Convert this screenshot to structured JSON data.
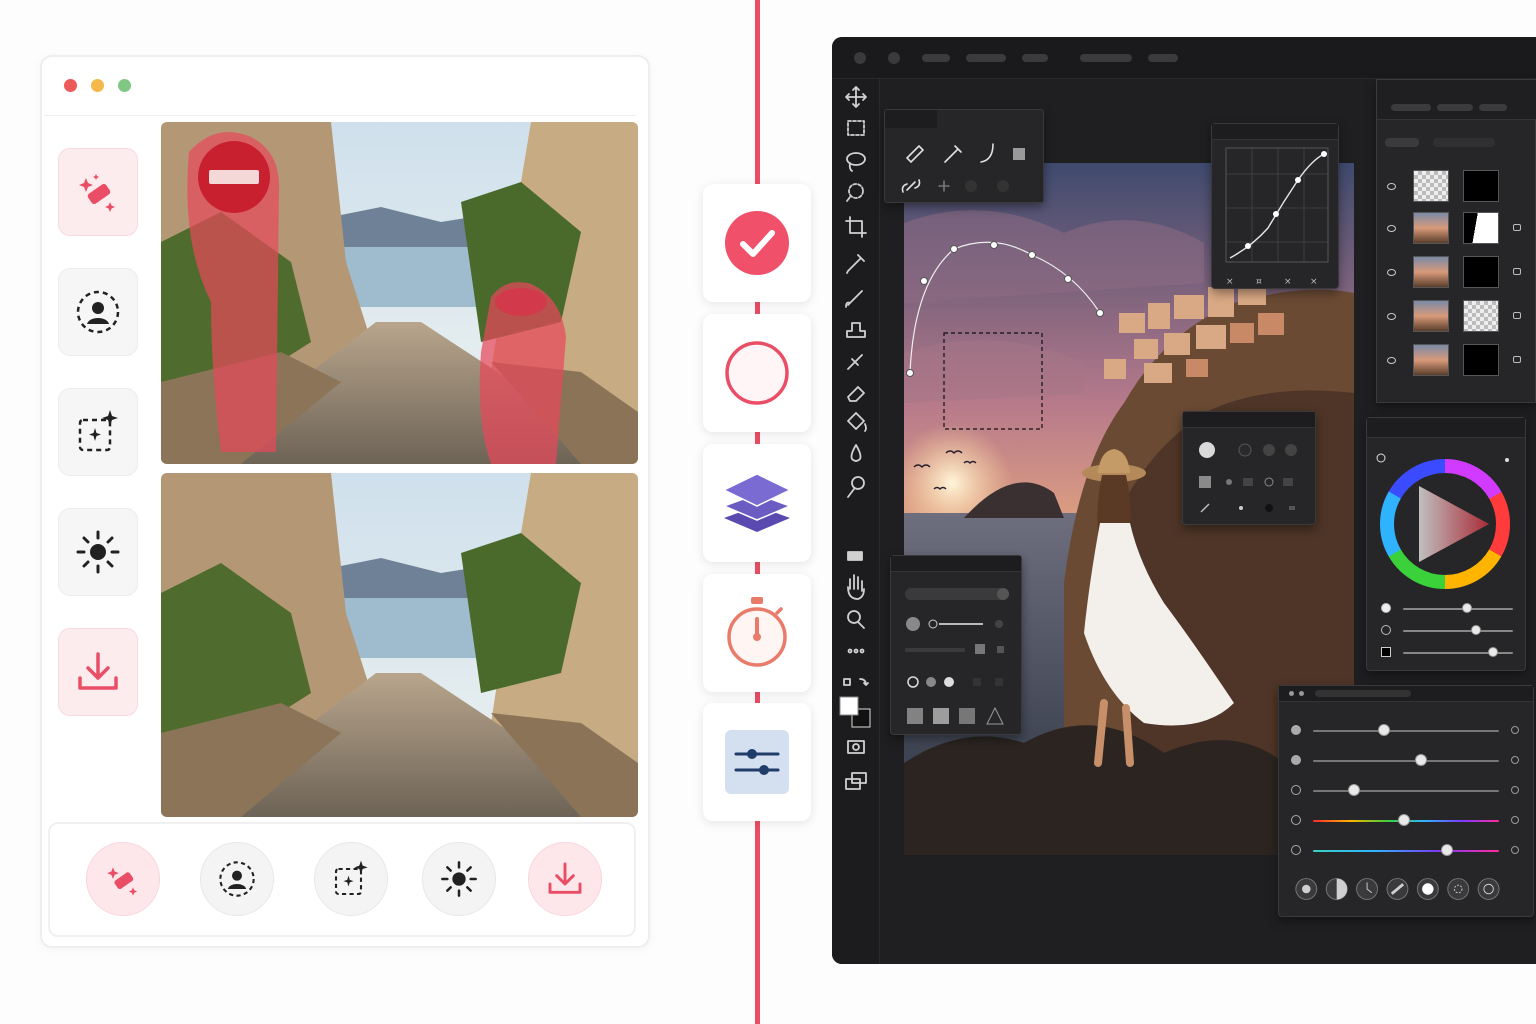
{
  "colors": {
    "accent": "#ea4e66",
    "accent_light": "#fde7ea",
    "traffic_red": "#ed5a5a",
    "traffic_yellow": "#f5b84c",
    "traffic_green": "#80c783",
    "layers_purple": "#6a5bc2",
    "timer_coral": "#ea7b6b",
    "editor_bg": "#1f1f21"
  },
  "left_app": {
    "window_controls": [
      "close",
      "minimize",
      "maximize"
    ],
    "sidebar_icons": [
      "magic-eraser-icon",
      "person-select-icon",
      "ai-select-icon",
      "brightness-icon",
      "download-icon"
    ],
    "bottom_icons": [
      "magic-eraser-icon",
      "person-select-icon",
      "ai-select-icon",
      "brightness-icon",
      "download-icon"
    ],
    "photos": [
      "before-photo-masked",
      "after-photo-clean"
    ]
  },
  "middle_strip": {
    "icons": [
      "check-circle-icon",
      "empty-circle-icon",
      "layers-stack-icon",
      "stopwatch-icon",
      "sliders-icon"
    ]
  },
  "editor": {
    "tools": [
      "move-icon",
      "marquee-icon",
      "lasso-icon",
      "quick-select-icon",
      "crop-icon",
      "eyedropper-icon",
      "brush-icon",
      "stamp-icon",
      "healing-icon",
      "eraser-icon",
      "fill-icon",
      "blur-icon",
      "dodge-icon",
      "rectangle-icon",
      "hand-icon",
      "zoom-icon",
      "more-icon",
      "swap-colors-icon",
      "foreground-color-icon",
      "quick-mask-icon",
      "screen-mode-icon"
    ],
    "layers": [
      {
        "visible": true,
        "thumb": "checker",
        "mask": "black"
      },
      {
        "visible": true,
        "thumb": "photo",
        "mask": "white-shape"
      },
      {
        "visible": true,
        "thumb": "photo",
        "mask": "black"
      },
      {
        "visible": true,
        "thumb": "photo",
        "mask": "checker"
      },
      {
        "visible": true,
        "thumb": "photo",
        "mask": "black"
      }
    ],
    "adjust_sliders": [
      0.38,
      0.58,
      0.22,
      0.49,
      0.72
    ],
    "color_sliders": [
      0.58,
      0.66,
      0.82
    ]
  }
}
